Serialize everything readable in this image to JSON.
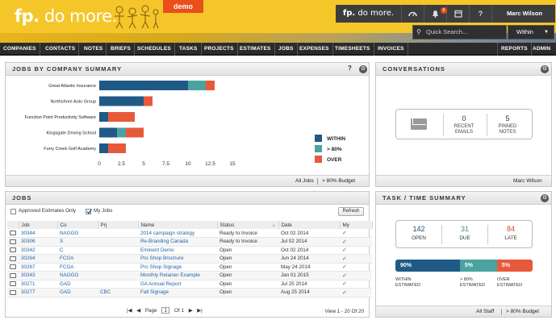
{
  "header": {
    "logo_bold": "fp.",
    "logo_text": " do more.",
    "demo_label": "demo",
    "topbar_logo_bold": "fp.",
    "topbar_logo_text": " do more.",
    "notification_count": "6",
    "user_name": "Marc Wilson",
    "search_placeholder": "Quick Search...",
    "search_scope": "Within"
  },
  "nav": {
    "items": [
      "COMPANIES",
      "CONTACTS",
      "NOTES",
      "BRIEFS",
      "SCHEDULES",
      "TASKS",
      "PROJECTS",
      "ESTIMATES",
      "JOBS",
      "EXPENSES",
      "TIMESHEETS",
      "INVOICES"
    ],
    "right_items": [
      "REPORTS",
      "ADMIN"
    ]
  },
  "jobs_summary": {
    "title": "JOBS BY COMPANY SUMMARY",
    "footer_links": [
      "All Jobs",
      "> 80% Budget"
    ]
  },
  "chart_data": {
    "type": "bar",
    "orientation": "horizontal",
    "stacked": true,
    "categories": [
      "Great Atlantic Insurance",
      "Northshore Auto Group",
      "Function Point Productivity Software",
      "Kingsgate Driving School",
      "Furry Creek Golf Academy"
    ],
    "series": [
      {
        "name": "WITHIN",
        "color": "#1f5a87",
        "values": [
          10,
          5,
          1,
          2,
          1
        ]
      },
      {
        "name": "> 80%",
        "color": "#4aa3a0",
        "values": [
          2,
          0,
          0,
          1,
          0
        ]
      },
      {
        "name": "OVER",
        "color": "#e8593a",
        "values": [
          1,
          1,
          3,
          2,
          2
        ]
      }
    ],
    "xticks": [
      "0",
      "2.5",
      "5",
      "7.5",
      "10",
      "12.5",
      "15"
    ],
    "xlim": [
      0,
      15
    ],
    "legend_position": "right"
  },
  "conversations": {
    "title": "CONVERSATIONS",
    "recent_count": "0",
    "recent_label": "RECENT EMAILS",
    "pinned_count": "5",
    "pinned_label": "PINNED NOTES",
    "footer_user": "Marc Wilson"
  },
  "jobs": {
    "title": "JOBS",
    "approved_label": "Approved Estimates Only",
    "my_jobs_label": "My Jobs",
    "refresh_label": "Refresh",
    "columns": [
      "Job",
      "Co",
      "Prj",
      "Name",
      "Status",
      "Date",
      "My"
    ],
    "rows": [
      {
        "job": "30344",
        "co": "NAGGG",
        "prj": "",
        "name": "2014 campaign strategy",
        "status": "Ready to Invoice",
        "date": "Oct 02 2014"
      },
      {
        "job": "30306",
        "co": "S",
        "prj": "",
        "name": "Re-Branding Canada",
        "status": "Ready to Invoice",
        "date": "Jul 02 2014"
      },
      {
        "job": "30342",
        "co": "C",
        "prj": "",
        "name": "Eminent Demo",
        "status": "Open",
        "date": "Oct 02 2014"
      },
      {
        "job": "30264",
        "co": "FCGA",
        "prj": "",
        "name": "Pro Shop Brochure",
        "status": "Open",
        "date": "Jun 24 2014"
      },
      {
        "job": "30267",
        "co": "FCGA",
        "prj": "",
        "name": "Pro Shop Signage",
        "status": "Open",
        "date": "May 24 2014"
      },
      {
        "job": "30343",
        "co": "NAGGG",
        "prj": "",
        "name": "Monthly Retainer Example",
        "status": "Open",
        "date": "Jan 01 2015"
      },
      {
        "job": "30271",
        "co": "GAD",
        "prj": "",
        "name": "GA Annual Report",
        "status": "Open",
        "date": "Jul 25 2014"
      },
      {
        "job": "30277",
        "co": "GAD",
        "prj": "CBC",
        "name": "Fall Signage",
        "status": "Open",
        "date": "Aug 25 2014"
      }
    ],
    "pager_page_label": "Page",
    "pager_page": "1",
    "pager_of": "Of 1",
    "view_info": "View 1 - 20 Of 20"
  },
  "task_summary": {
    "title": "TASK / TIME SUMMARY",
    "open_count": "142",
    "open_label": "OPEN",
    "due_count": "31",
    "due_label": "DUE",
    "late_count": "84",
    "late_label": "LATE",
    "bar": [
      {
        "label": "90%",
        "fraction": 0.47,
        "color": "#1f5a87"
      },
      {
        "label": "5%",
        "fraction": 0.27,
        "color": "#4aa3a0"
      },
      {
        "label": "5%",
        "fraction": 0.26,
        "color": "#e8593a"
      }
    ],
    "caption_within": "WITHIN ESTIMATED",
    "caption_80": "> 80% ESTIMATED",
    "caption_over": "OVER ESTIMATED",
    "footer_links": [
      "All Staff",
      "> 80% Budget"
    ]
  },
  "colors": {
    "header_yellow": "#f5c62a",
    "demo_orange": "#e94e1b",
    "within_blue": "#1f5a87",
    "near_teal": "#4aa3a0",
    "over_orange": "#e8593a",
    "link_blue": "#2266aa"
  }
}
